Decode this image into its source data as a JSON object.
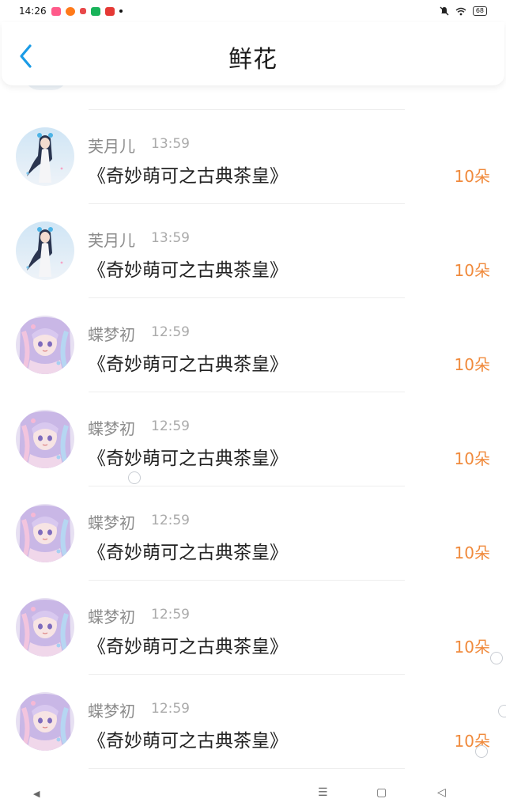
{
  "status_bar": {
    "time": "14:26",
    "app_icons": [
      {
        "name": "app-icon-pink",
        "color": "#ff5a8a"
      },
      {
        "name": "app-icon-orange",
        "color": "#ff7a1a"
      },
      {
        "name": "app-icon-red",
        "color": "#e8484a"
      },
      {
        "name": "app-icon-green",
        "color": "#19b35a"
      },
      {
        "name": "app-icon-heart",
        "color": "#e53935"
      }
    ],
    "battery": "68"
  },
  "header": {
    "title": "鲜花",
    "back_icon": "chevron-left-icon",
    "accent": "#1a9be6"
  },
  "list": {
    "items": [
      {
        "name": "芙月儿",
        "time": "13:59",
        "gift": "《奇妙萌可之古典茶皇》",
        "count": "10朵",
        "avatar": "blue-hair"
      },
      {
        "name": "芙月儿",
        "time": "13:59",
        "gift": "《奇妙萌可之古典茶皇》",
        "count": "10朵",
        "avatar": "blue-hair"
      },
      {
        "name": "蝶梦初",
        "time": "12:59",
        "gift": "《奇妙萌可之古典茶皇》",
        "count": "10朵",
        "avatar": "pastel-hair"
      },
      {
        "name": "蝶梦初",
        "time": "12:59",
        "gift": "《奇妙萌可之古典茶皇》",
        "count": "10朵",
        "avatar": "pastel-hair"
      },
      {
        "name": "蝶梦初",
        "time": "12:59",
        "gift": "《奇妙萌可之古典茶皇》",
        "count": "10朵",
        "avatar": "pastel-hair"
      },
      {
        "name": "蝶梦初",
        "time": "12:59",
        "gift": "《奇妙萌可之古典茶皇》",
        "count": "10朵",
        "avatar": "pastel-hair"
      },
      {
        "name": "蝶梦初",
        "time": "12:59",
        "gift": "《奇妙萌可之古典茶皇》",
        "count": "10朵",
        "avatar": "pastel-hair"
      }
    ]
  },
  "colors": {
    "count": "#f08a3c",
    "name": "#8c8c8c",
    "time": "#aaaaaa"
  },
  "nav_bar": {
    "icons": [
      "back-triangle-icon",
      "menu-icon",
      "home-square-icon",
      "back-nav-icon"
    ]
  }
}
